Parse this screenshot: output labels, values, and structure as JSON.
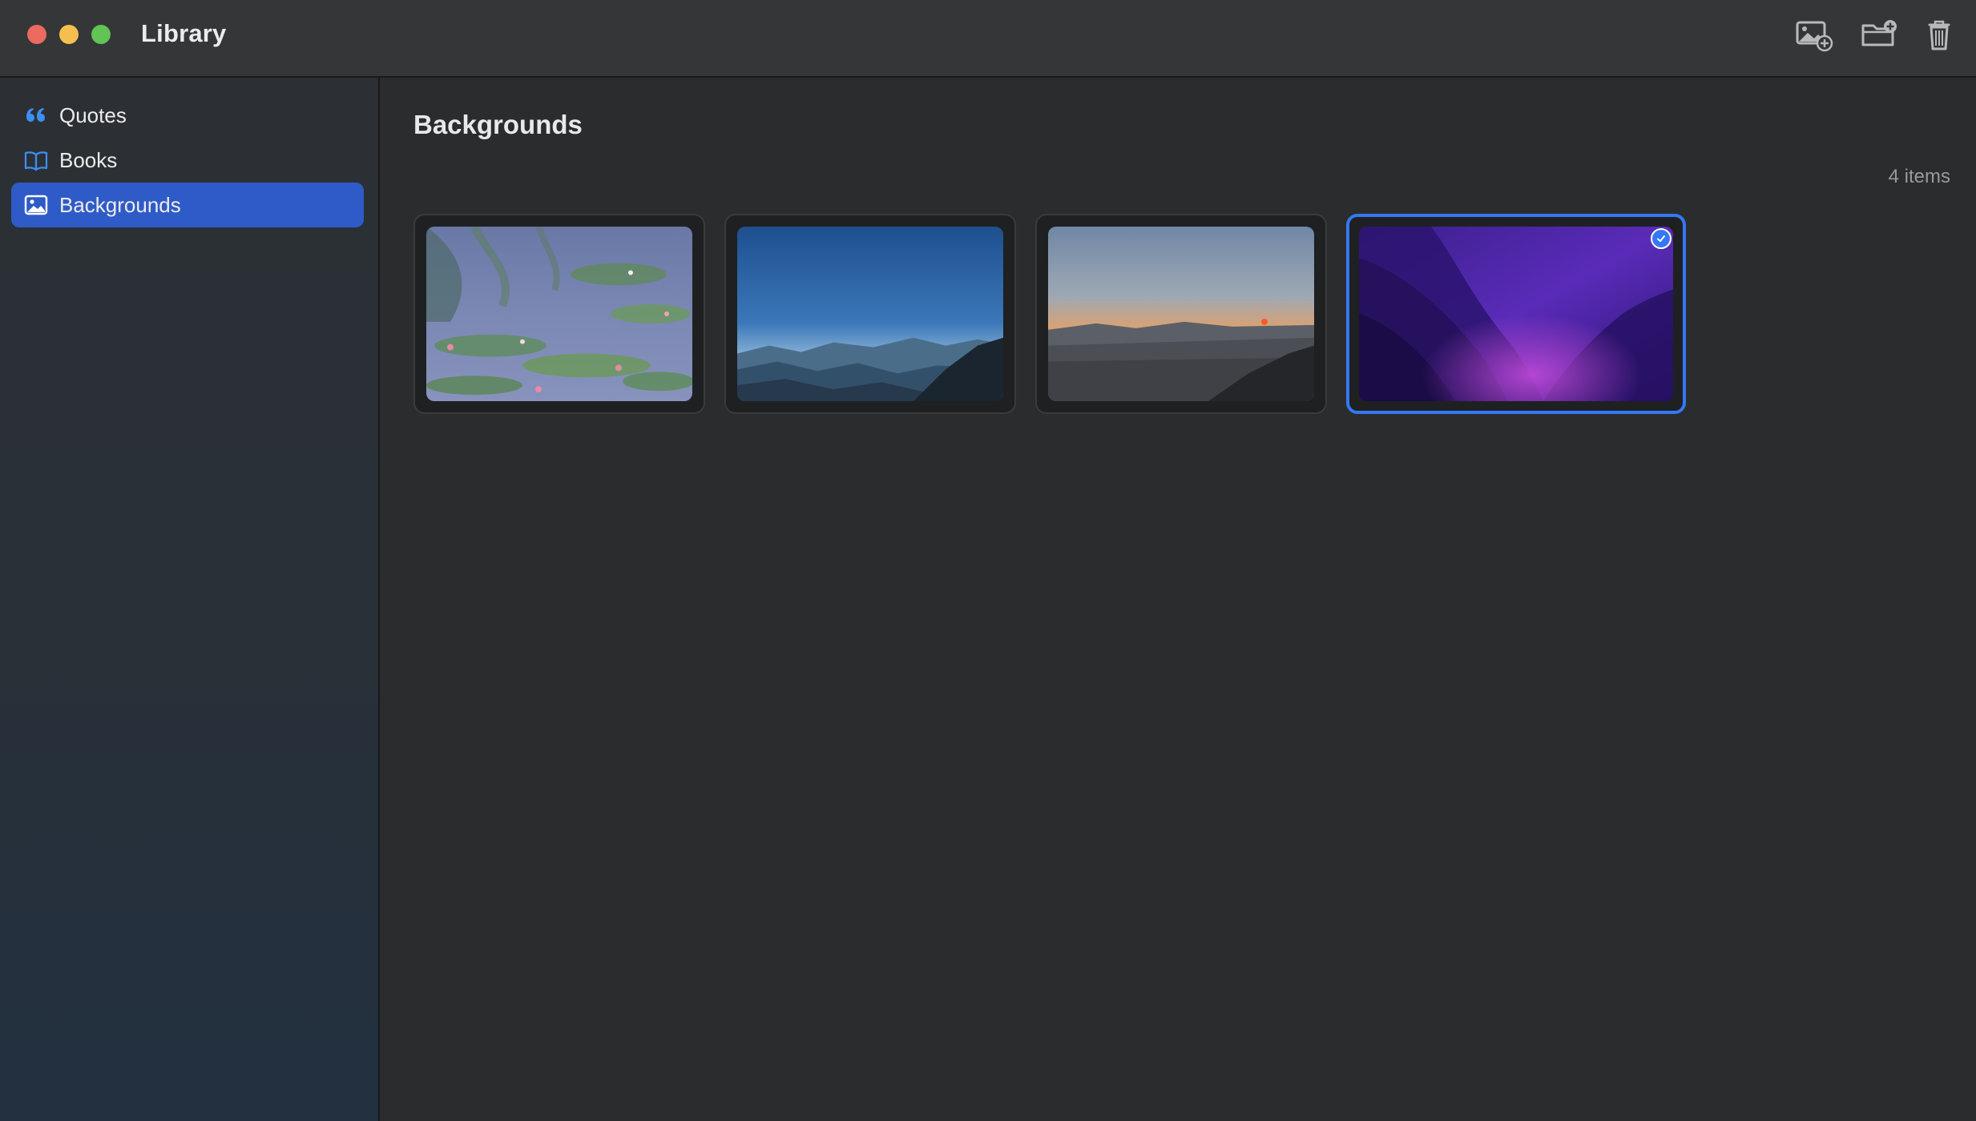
{
  "window": {
    "title": "Library",
    "toolbar": {
      "add_image_icon": "photo-badge-plus-icon",
      "add_folder_icon": "folder-badge-plus-icon",
      "trash_icon": "trash-icon"
    }
  },
  "sidebar": {
    "items": [
      {
        "label": "Quotes",
        "icon": "quote-icon",
        "selected": false
      },
      {
        "label": "Books",
        "icon": "book-icon",
        "selected": false
      },
      {
        "label": "Backgrounds",
        "icon": "photo-icon",
        "selected": true
      }
    ]
  },
  "main": {
    "title": "Backgrounds",
    "item_count": "4 items",
    "thumbnails": [
      {
        "subject": "water lilies painting",
        "selected": false
      },
      {
        "subject": "blue sky over mountains",
        "selected": false
      },
      {
        "subject": "sunset over city",
        "selected": false
      },
      {
        "subject": "purple abstract wallpaper",
        "selected": true
      }
    ]
  },
  "colors": {
    "accent": "#3478f6",
    "sidebar_selection": "#2f5bc8",
    "close": "#ed6a5e",
    "minimize": "#f5bf4f",
    "zoom": "#61c454"
  }
}
